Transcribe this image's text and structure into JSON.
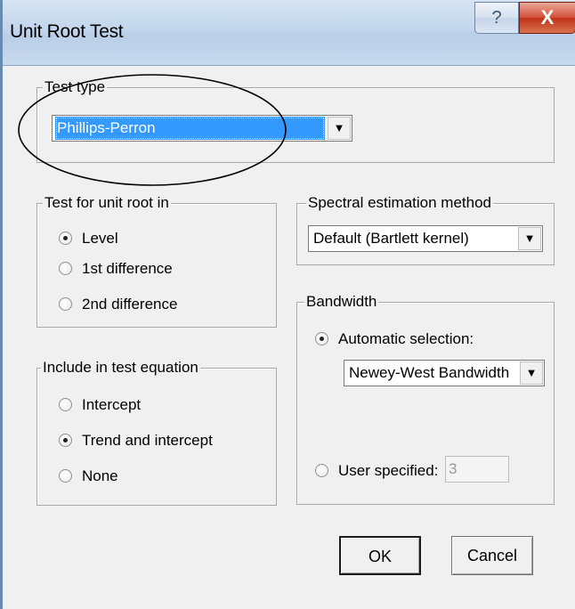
{
  "window": {
    "title": "Unit Root Test",
    "help_glyph": "?",
    "close_glyph": "X"
  },
  "test_type": {
    "legend": "Test type",
    "selected": "Phillips-Perron",
    "arrow_glyph": "▼"
  },
  "unit_root_in": {
    "legend": "Test for unit root in",
    "options": [
      {
        "label": "Level",
        "checked": true
      },
      {
        "label": "1st difference",
        "checked": false
      },
      {
        "label": "2nd difference",
        "checked": false
      }
    ]
  },
  "include_in_equation": {
    "legend": "Include in test equation",
    "options": [
      {
        "label": "Intercept",
        "checked": false
      },
      {
        "label": "Trend and intercept",
        "checked": true
      },
      {
        "label": "None",
        "checked": false
      }
    ]
  },
  "spectral": {
    "legend": "Spectral estimation method",
    "selected": "Default  (Bartlett kernel)",
    "arrow_glyph": "▼"
  },
  "bandwidth": {
    "legend": "Bandwidth",
    "automatic_label": "Automatic selection:",
    "automatic_checked": true,
    "automatic_selected": "Newey-West Bandwidth",
    "arrow_glyph": "▼",
    "user_label": "User specified:",
    "user_checked": false,
    "user_value": "3"
  },
  "buttons": {
    "ok": "OK",
    "cancel": "Cancel"
  },
  "colors": {
    "selection": "#3399ff",
    "annotation_ellipse": "#000000"
  }
}
